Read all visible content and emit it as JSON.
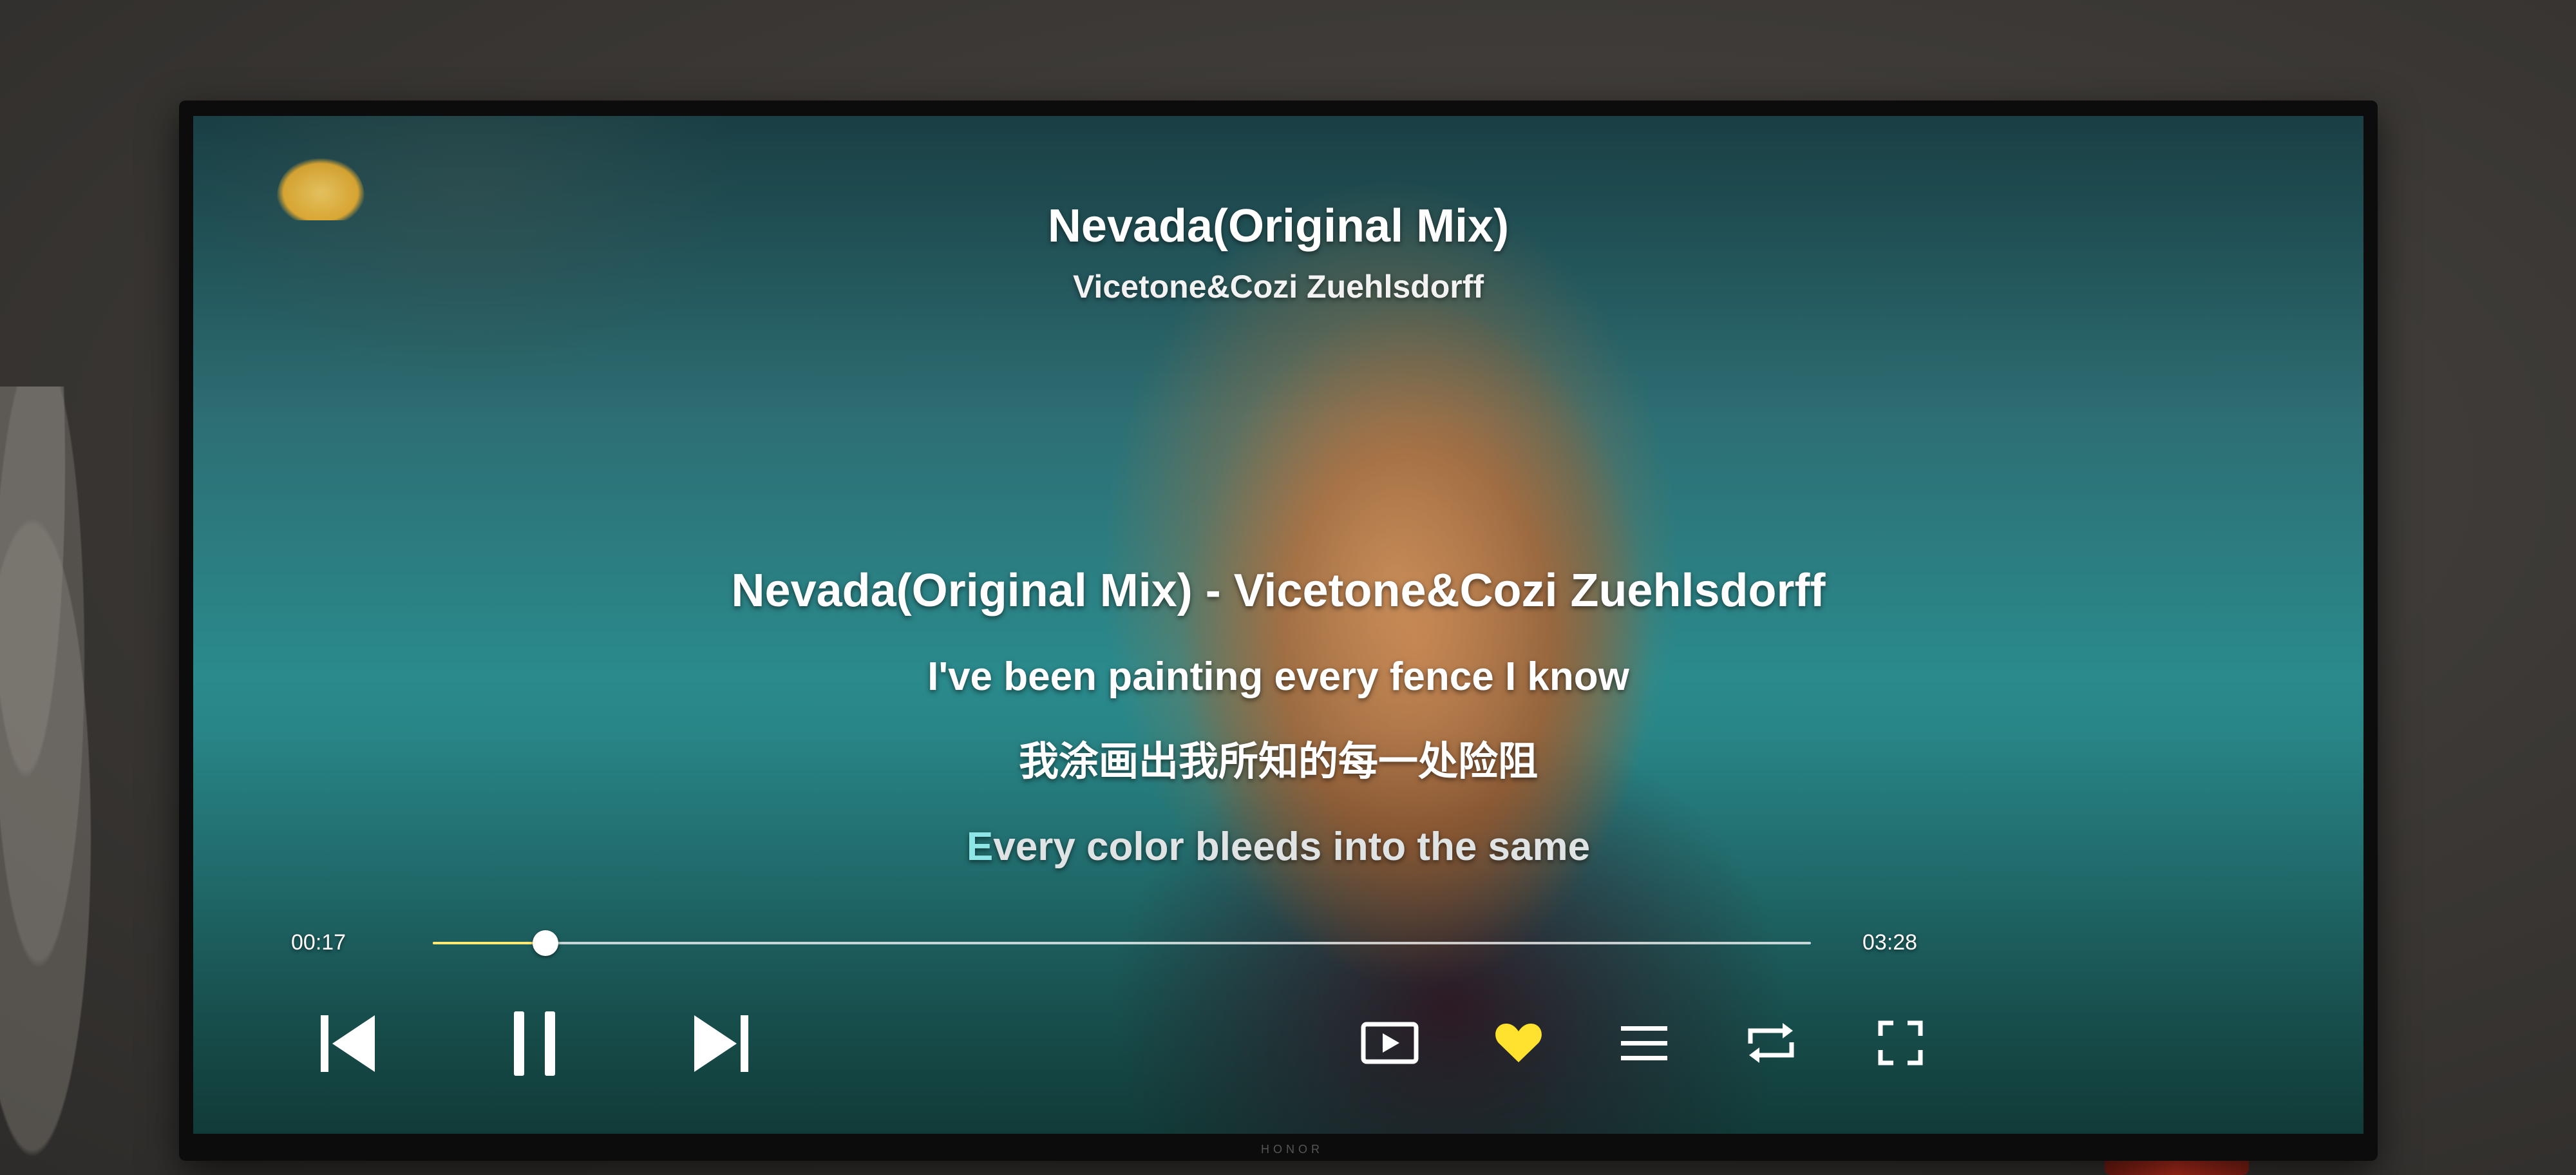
{
  "player": {
    "song_title": "Nevada(Original Mix)",
    "artist": "Vicetone&Cozi Zuehlsdorff",
    "lyrics": {
      "header": "Nevada(Original Mix) - Vicetone&Cozi Zuehlsdorff",
      "line_1": "I've been painting every fence I know",
      "line_2": "我涂画出我所知的每一处险阻",
      "current_highlighted": "E",
      "current_rest": "very color bleeds into the same"
    },
    "time_elapsed": "00:17",
    "time_total": "03:28",
    "progress_fraction": 0.082
  },
  "controls": {
    "previous_icon": "skip-previous-icon",
    "pause_icon": "pause-icon",
    "next_icon": "skip-next-icon",
    "mv_icon": "play-video-icon",
    "favorite_icon": "heart-icon",
    "playlist_icon": "list-icon",
    "loop_icon": "repeat-icon",
    "fullscreen_icon": "fullscreen-icon"
  },
  "colors": {
    "favorite_active": "#ffe22e",
    "progress_played": "#ffe873",
    "lyric_highlight": "#8fe6e6"
  },
  "tv": {
    "brand": "HONOR"
  }
}
